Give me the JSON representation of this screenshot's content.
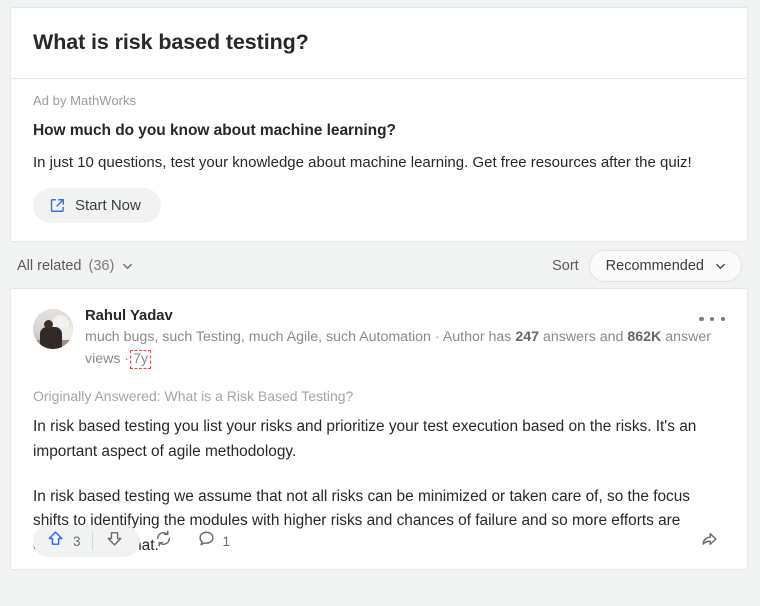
{
  "question": {
    "title": "What is risk based testing?"
  },
  "ad": {
    "label": "Ad by MathWorks",
    "headline": "How much do you know about machine learning?",
    "body": "In just 10 questions, test your knowledge about machine learning. Get free resources after the quiz!",
    "cta_label": "Start Now",
    "cta_icon": "external-link-icon",
    "accent_color": "#3a6df0"
  },
  "filters": {
    "all_related_label": "All related",
    "all_related_count": "(36)",
    "all_related_icon": "chevron-down-icon",
    "sort_label": "Sort",
    "sort_value": "Recommended",
    "sort_icon": "chevron-down-icon",
    "sort_options": [
      "Recommended"
    ]
  },
  "answer": {
    "author_name": "Rahul Yadav",
    "avatar_icon": "user-photo-avatar",
    "credential": "much bugs, such Testing, much Agile, such Automation · Author has ",
    "answers_count": "247",
    "credential_mid": " answers and ",
    "views_count": "862K",
    "credential_end": " answer views ·",
    "timestamp": "7y",
    "more_icon": "ellipsis-horizontal-icon",
    "originally_answered": "Originally Answered: What is a Risk Based Testing?",
    "paragraph_1": "In risk based testing you list your risks and prioritize your test execution based on the risks. It's an important aspect of agile methodology.",
    "paragraph_2": "In risk based testing we assume that not all risks can be minimized or taken care of, so the focus shifts to identifying the modules with higher risks and chances of failure and so more efforts are channalled to that.",
    "highlight_color": "#e84c3d"
  },
  "actions": {
    "upvote_icon": "upvote-arrow-icon",
    "upvote_count": "3",
    "upvote_color": "#2e69ff",
    "downvote_icon": "downvote-arrow-icon",
    "repost_icon": "repost-cycle-icon",
    "comment_icon": "comment-bubble-icon",
    "comment_count": "1",
    "share_icon": "share-arrow-icon"
  }
}
